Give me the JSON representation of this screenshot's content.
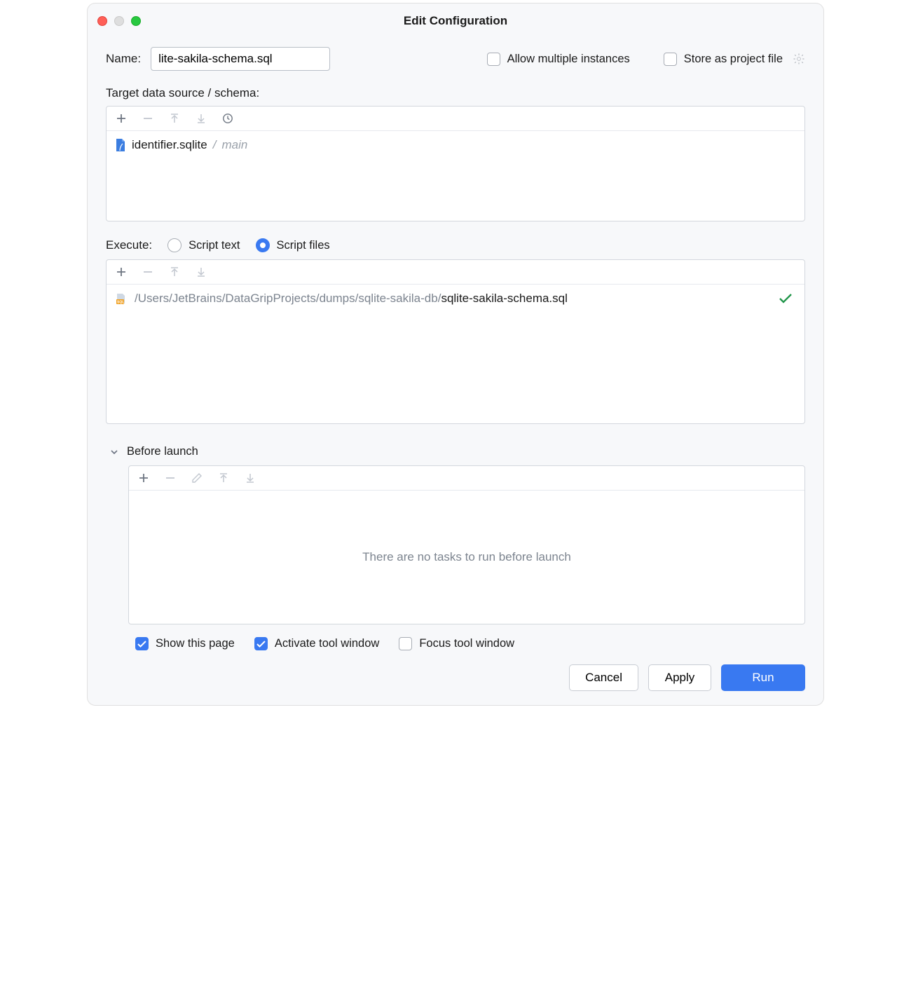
{
  "window": {
    "title": "Edit Configuration"
  },
  "name": {
    "label": "Name:",
    "value": "lite-sakila-schema.sql"
  },
  "options": {
    "allow_multiple": "Allow multiple instances",
    "store_project": "Store as project file"
  },
  "target": {
    "label": "Target data source / schema:",
    "item": {
      "name": "identifier.sqlite",
      "schema": "main"
    }
  },
  "execute": {
    "label": "Execute:",
    "script_text": "Script text",
    "script_files": "Script files"
  },
  "file": {
    "dir": "/Users/JetBrains/DataGripProjects/dumps/sqlite-sakila-db/",
    "name": "sqlite-sakila-schema.sql"
  },
  "before": {
    "label": "Before launch",
    "empty": "There are no tasks to run before launch"
  },
  "bottom": {
    "show_page": "Show this page",
    "activate": "Activate tool window",
    "focus": "Focus tool window"
  },
  "buttons": {
    "cancel": "Cancel",
    "apply": "Apply",
    "run": "Run"
  }
}
